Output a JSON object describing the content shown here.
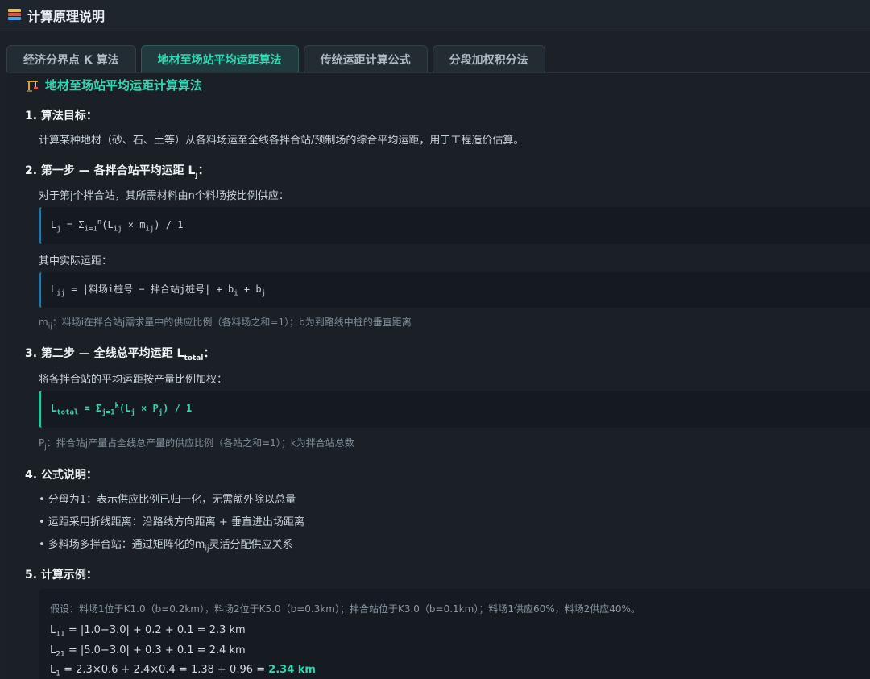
{
  "window": {
    "title": "计算原理说明"
  },
  "tabs": [
    {
      "label": "经济分界点 K 算法"
    },
    {
      "label": "地材至场站平均运距算法"
    },
    {
      "label": "传统运距计算公式"
    },
    {
      "label": "分段加权积分法"
    }
  ],
  "section": {
    "title": "地材至场站平均运距计算算法",
    "s1": {
      "heading": "1. 算法目标：",
      "text": "计算某种地材（砂、石、土等）从各料场运至全线各拌合站/预制场的综合平均运距，用于工程造价估算。"
    },
    "s2": {
      "heading_prefix": "2. 第一步 — 各拌合站平均运距 L",
      "heading_sub": "j",
      "heading_suffix": "：",
      "text1": "对于第j个拌合站，其所需材料由n个料场按比例供应：",
      "text2": "其中实际运距：",
      "note_prefix": "m",
      "note_sub": "ij",
      "note_suffix": "：料场i在拌合站j需求量中的供应比例（各料场之和=1）；b为到路线中桩的垂直距离"
    },
    "s3": {
      "heading_prefix": "3. 第二步 — 全线总平均运距 L",
      "heading_sub": "total",
      "heading_suffix": "：",
      "text1": "将各拌合站的平均运距按产量比例加权：",
      "note_prefix": "P",
      "note_sub": "j",
      "note_suffix": "：拌合站j产量占全线总产量的供应比例（各站之和=1）；k为拌合站总数"
    },
    "s4": {
      "heading": "4. 公式说明：",
      "b1": "• 分母为1：表示供应比例已归一化，无需额外除以总量",
      "b2": "• 运距采用折线距离：沿路线方向距离 + 垂直进出场距离",
      "b3_prefix": "• 多料场多拌合站：通过矩阵化的m",
      "b3_sub": "ij",
      "b3_suffix": "灵活分配供应关系"
    },
    "s5": {
      "heading": "5. 计算示例：",
      "assume": "假设：料场1位于K1.0（b=0.2km），料场2位于K5.0（b=0.3km）；拌合站位于K3.0（b=0.1km）；料场1供应60%，料场2供应40%。",
      "l11_rhs": "= |1.0−3.0| + 0.2 + 0.1 = 2.3 km",
      "l21_rhs": "= |5.0−3.0| + 0.3 + 0.1 = 2.4 km",
      "l1_rhs": "= 2.3×0.6 + 2.4×0.4 = 1.38 + 0.96 =",
      "l1_result": "2.34 km"
    }
  }
}
